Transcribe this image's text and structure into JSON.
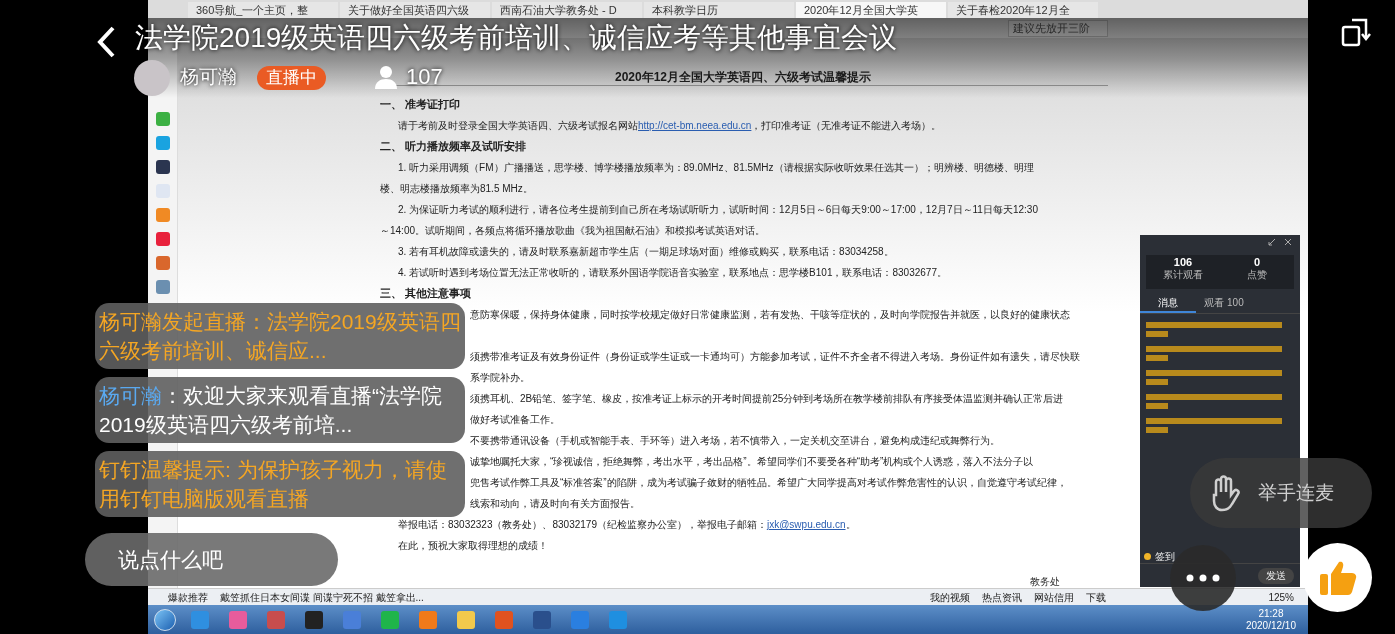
{
  "live": {
    "title": "法学院2019级英语四六级考前培训、诚信应考等其他事宜会议",
    "host": "杨可瀚",
    "status_badge": "直播中",
    "viewer_count": "107"
  },
  "browser": {
    "tabs": [
      {
        "label": "360导航_一个主页，整",
        "selected": false
      },
      {
        "label": "关于做好全国英语四六级",
        "selected": false
      },
      {
        "label": "西南石油大学教务处 - D",
        "selected": false
      },
      {
        "label": "本科教学日历",
        "selected": false
      },
      {
        "label": "2020年12月全国大学英",
        "selected": true
      },
      {
        "label": "关于春检2020年12月全",
        "selected": false
      }
    ],
    "search_placeholder": "建议先放开三阶"
  },
  "document": {
    "title": "2020年12月全国大学英语四、六级考试温馨提示",
    "paragraphs": [
      {
        "kind": "heading",
        "text": "一、 准考证打印"
      },
      {
        "kind": "indent",
        "text": "请于考前及时登录全国大学英语四、六级考试报名网站",
        "link": "http://cet-bm.neea.edu.cn",
        "after": "，打印准考证（无准考证不能进入考场）。"
      },
      {
        "kind": "heading",
        "text": "二、 听力播放频率及试听安排"
      },
      {
        "kind": "indent",
        "text": "1. 听力采用调频（FM）广播播送，思学楼、博学楼播放频率为：89.0MHz、81.5MHz（请根据实际收听效果任选其一）；明辨楼、明德楼、明理"
      },
      {
        "kind": "line",
        "text": "楼、明志楼播放频率为81.5 MHz。"
      },
      {
        "kind": "indent",
        "text": "2. 为保证听力考试的顺利进行，请各位考生提前到自己所在考场试听听力，试听时间：12月5日～6日每天9:00～17:00，12月7日～11日每天12:30"
      },
      {
        "kind": "line",
        "text": "～14:00。试听期间，各频点将循环播放歌曲《我为祖国献石油》和模拟考试英语对话。"
      },
      {
        "kind": "indent",
        "text": "3. 若有耳机故障或遗失的，请及时联系嘉新超市学生店（一期足球场对面）维修或购买，联系电话：83034258。"
      },
      {
        "kind": "indent",
        "text": "4. 若试听时遇到考场位置无法正常收听的，请联系外国语学院语音实验室，联系地点：思学楼B101，联系电话：83032677。"
      },
      {
        "kind": "heading",
        "text": "三、 其他注意事项"
      },
      {
        "kind": "partial",
        "text": "意防寒保暖，保持身体健康，同时按学校规定做好日常健康监测，若有发热、干咳等症状的，及时向学院报告并就医，以良好的健康状态",
        "covered_line_after": true
      },
      {
        "kind": "partial",
        "text": "须携带准考证及有效身份证件（身份证或学生证或一卡通均可）方能参加考试，证件不齐全者不得进入考场。身份证件如有遗失，请尽快联"
      },
      {
        "kind": "partial",
        "text": "系学院补办。"
      },
      {
        "kind": "partial",
        "text": "须携耳机、2B铅笔、签字笔、橡皮，按准考证上标示的开考时间提前25分钟到考场所在教学楼前排队有序接受体温监测并确认正常后进"
      },
      {
        "kind": "partial",
        "text": "做好考试准备工作。"
      },
      {
        "kind": "partial",
        "text": "不要携带通讯设备（手机或智能手表、手环等）进入考场，若不慎带入，一定关机交至讲台，避免构成违纪或舞弊行为。"
      },
      {
        "kind": "partial",
        "text": "诚挚地嘱托大家，“珍视诚信，拒绝舞弊，考出水平，考出品格”。希望同学们不要受各种“助考”机构或个人诱惑，落入不法分子以"
      },
      {
        "kind": "partial",
        "text": "兜售考试作弊工具及“标准答案”的陷阱，成为考试骗子敛财的牺牲品。希望广大同学提高对考试作弊危害性的认识，自觉遵守考试纪律，"
      },
      {
        "kind": "partial",
        "text": "线索和动向，请及时向有关方面报告。"
      },
      {
        "kind": "indent",
        "text": "举报电话：83032323（教务处）、83032179（纪检监察办公室），举报电子邮箱：",
        "link": "jxk@swpu.edu.cn",
        "after": "。"
      },
      {
        "kind": "indent",
        "text": "在此，预祝大家取得理想的成绩！"
      }
    ],
    "signature": "教务处"
  },
  "chat_panel": {
    "total_views": "106",
    "total_views_label": "累计观看",
    "likes": "0",
    "likes_label": "点赞",
    "tabs": [
      {
        "label": "消息",
        "selected": true
      },
      {
        "label": "观看 100",
        "selected": false
      }
    ],
    "sign_in": "签到",
    "send": "发送"
  },
  "status_bar": {
    "left_items": [
      "爆款推荐",
      "戴笠抓住日本女间谍 间谍宁死不招 戴笠拿出..."
    ],
    "right_items": [
      "我的视频",
      "热点资讯",
      "网站信用",
      "下载"
    ],
    "zoom": "125%"
  },
  "taskbar": {
    "time": "21:28",
    "date": "2020/12/10"
  },
  "comments": [
    {
      "kind": "system",
      "text": "杨可瀚发起直播：法学院2019级英语四六级考前培训、诚信应..."
    },
    {
      "kind": "user",
      "name": "杨可瀚",
      "text": "：欢迎大家来观看直播“法学院2019级英语四六级考前培..."
    },
    {
      "kind": "system",
      "text": "钉钉温馨提示: 为保护孩子视力，请使用钉钉电脑版观看直播"
    }
  ],
  "comment_input": {
    "placeholder": "说点什么吧"
  },
  "raise_hand": "举手连麦"
}
